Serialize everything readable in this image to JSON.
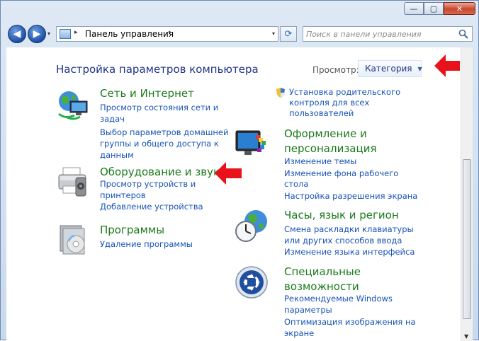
{
  "window": {
    "min_glyph": "—",
    "max_glyph": "▢",
    "close_glyph": "✕"
  },
  "nav": {
    "back_glyph": "◀",
    "forward_glyph": "▶",
    "recent_glyph": "▾",
    "refresh_glyph": "⟳"
  },
  "address": {
    "separator": "▸",
    "path": "Панель управления",
    "dropdown_glyph": "▾"
  },
  "search": {
    "placeholder": "Поиск в панели управления"
  },
  "main": {
    "heading": "Настройка параметров компьютера",
    "view_label": "Просмотр:",
    "view_value": "Категория",
    "view_caret": "▼"
  },
  "categories": {
    "network": {
      "title": "Сеть и Интернет",
      "links": [
        "Просмотр состояния сети и",
        "задач",
        "Выбор параметров домашней",
        "группы и общего доступа к",
        "данным"
      ],
      "icon": "network-globe-icon"
    },
    "hardware": {
      "title": "Оборудование и звук",
      "links": [
        "Просмотр устройств и",
        "принтеров",
        "Добавление устройства"
      ],
      "icon": "printer-icon"
    },
    "programs": {
      "title": "Программы",
      "links": [
        "Удаление программы"
      ],
      "icon": "programs-icon"
    },
    "parental": {
      "links": [
        "Установка родительского",
        "контроля для всех",
        "пользователей"
      ],
      "icon": "shield-icon"
    },
    "appearance": {
      "title": [
        "Оформление и",
        "персонализация"
      ],
      "links": [
        "Изменение темы",
        "Изменение фона рабочего",
        "стола",
        "Настройка разрешения экрана"
      ],
      "icon": "monitor-palette-icon"
    },
    "clock": {
      "title": "Часы, язык и регион",
      "links": [
        "Смена раскладки клавиатуры",
        "или других способов ввода",
        "Изменение языка интерфейса"
      ],
      "icon": "clock-globe-icon"
    },
    "access": {
      "title": [
        "Специальные",
        "возможности"
      ],
      "links": [
        "Рекомендуемые Windows",
        "параметры",
        "Оптимизация изображения на",
        "экране"
      ],
      "icon": "ease-of-access-icon"
    }
  },
  "colors": {
    "title_green": "#1a7a1a",
    "link_blue": "#1752b8",
    "heading_blue": "#1e3287",
    "arrow_red": "#e8121a"
  }
}
